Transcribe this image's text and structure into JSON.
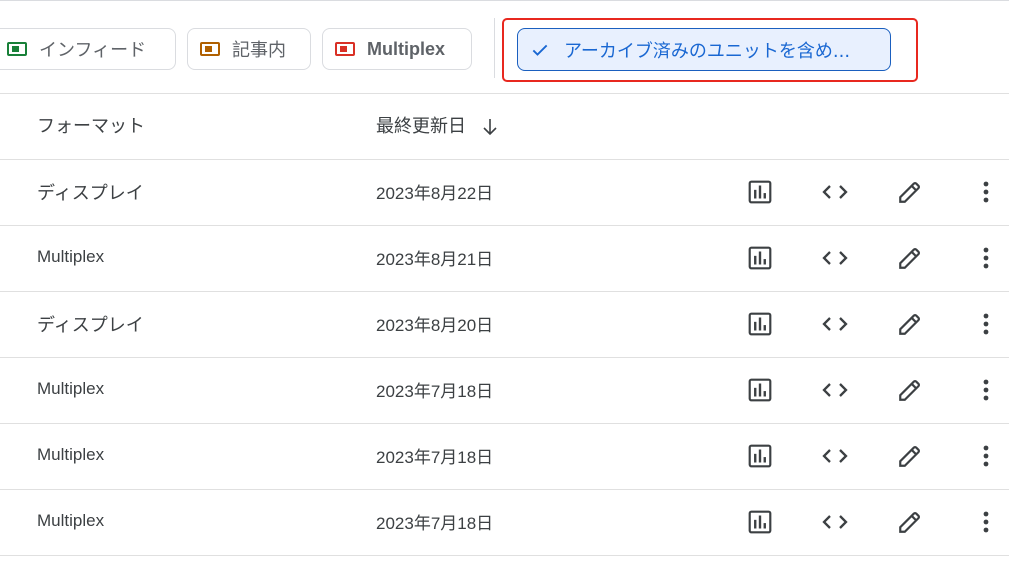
{
  "filters": {
    "chips": [
      {
        "label": "インフィード",
        "color": "#188038"
      },
      {
        "label": "記事内",
        "color": "#b06000"
      },
      {
        "label": "Multiplex",
        "color": "#d93025"
      }
    ],
    "archived_toggle": {
      "label": "アーカイブ済みのユニットを含め...",
      "selected": true,
      "accent": "#1967d2"
    }
  },
  "table": {
    "headers": {
      "format": "フォーマット",
      "last_updated": "最終更新日"
    },
    "rows": [
      {
        "format": "ディスプレイ",
        "date": "2023年8月22日"
      },
      {
        "format": "Multiplex",
        "date": "2023年8月21日"
      },
      {
        "format": "ディスプレイ",
        "date": "2023年8月20日"
      },
      {
        "format": "Multiplex",
        "date": "2023年7月18日"
      },
      {
        "format": "Multiplex",
        "date": "2023年7月18日"
      },
      {
        "format": "Multiplex",
        "date": "2023年7月18日"
      }
    ],
    "row_actions": [
      "report-icon",
      "code-icon",
      "edit-icon",
      "more-vert-icon"
    ]
  }
}
